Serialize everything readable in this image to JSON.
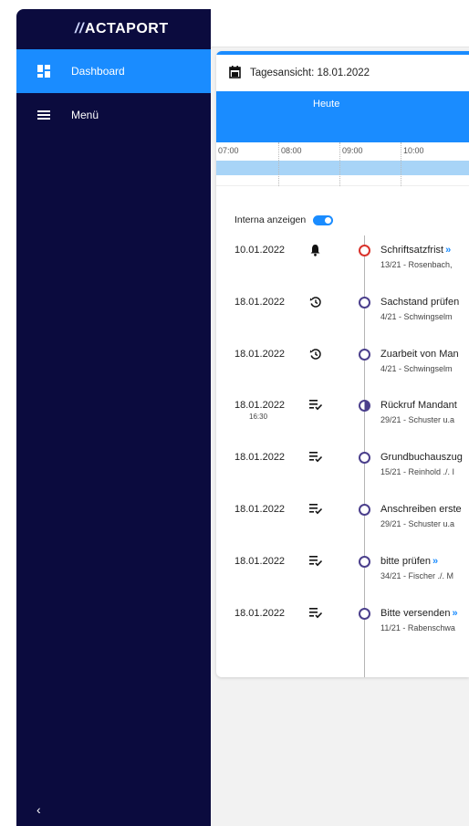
{
  "sidebar": {
    "logo": "ACTAPORT",
    "logo_prefix": "//",
    "items": [
      {
        "label": "Dashboard",
        "icon": "dashboard-icon",
        "active": true
      },
      {
        "label": "Menü",
        "icon": "menu-icon",
        "active": false
      }
    ],
    "collapse_label": "‹"
  },
  "card": {
    "title": "Tagesansicht: 18.01.2022",
    "today_label": "Heute",
    "hours": [
      "07:00",
      "08:00",
      "09:00",
      "10:00"
    ],
    "interna_label": "Interna anzeigen",
    "interna_enabled": true,
    "entries": [
      {
        "date": "10.01.2022",
        "time": "",
        "icon": "bell-icon",
        "status": "red",
        "title": "Schriftsatzfrist",
        "more": "»",
        "sub": "13/21 - Rosenbach,"
      },
      {
        "date": "18.01.2022",
        "time": "",
        "icon": "history-icon",
        "status": "open",
        "title": "Sachstand prüfen",
        "more": "",
        "sub": "4/21 - Schwingselm"
      },
      {
        "date": "18.01.2022",
        "time": "",
        "icon": "history-icon",
        "status": "open",
        "title": "Zuarbeit von Man",
        "more": "",
        "sub": "4/21 - Schwingselm"
      },
      {
        "date": "18.01.2022",
        "time": "16:30",
        "icon": "checklist-icon",
        "status": "half",
        "title": "Rückruf Mandant",
        "more": "",
        "sub": "29/21 - Schuster u.a"
      },
      {
        "date": "18.01.2022",
        "time": "",
        "icon": "checklist-icon",
        "status": "open",
        "title": "Grundbuchauszug",
        "more": "",
        "sub": "15/21 - Reinhold ./. I"
      },
      {
        "date": "18.01.2022",
        "time": "",
        "icon": "checklist-icon",
        "status": "open",
        "title": "Anschreiben erste",
        "more": "",
        "sub": "29/21 - Schuster u.a"
      },
      {
        "date": "18.01.2022",
        "time": "",
        "icon": "checklist-icon",
        "status": "open",
        "title": "bitte prüfen",
        "more": "»",
        "sub": "34/21 - Fischer ./. M"
      },
      {
        "date": "18.01.2022",
        "time": "",
        "icon": "checklist-icon",
        "status": "open",
        "title": "Bitte versenden",
        "more": "»",
        "sub": "11/21 - Rabenschwa"
      }
    ]
  },
  "colors": {
    "sidebar_bg": "#0b0b3e",
    "accent": "#1a8cff",
    "timebar": "#a8d4f7",
    "deadline": "#d9322b",
    "task": "#4b3f8c"
  }
}
